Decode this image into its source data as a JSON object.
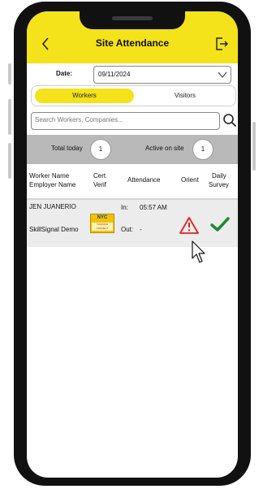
{
  "header": {
    "title": "Site Attendance",
    "status_left": "",
    "status_right": "",
    "back_icon": "chevron-left-icon",
    "logout_icon": "logout-icon"
  },
  "filters": {
    "date_label": "Date:",
    "date_value": "09/11/2024"
  },
  "tabs": [
    {
      "label": "Workers",
      "active": true
    },
    {
      "label": "Visitors",
      "active": false
    }
  ],
  "search": {
    "placeholder": "Search Workers, Companies..."
  },
  "stats": {
    "total_label": "Total today",
    "total_value": "1",
    "active_label": "Active on site",
    "active_value": "1"
  },
  "table": {
    "headers": {
      "worker_line1": "Worker Name",
      "worker_line2": "Employer Name",
      "cert_line1": "Cert",
      "cert_line2": "Verif",
      "attendance": "Attendance",
      "orient": "Orient",
      "survey_line1": "Daily",
      "survey_line2": "Survey"
    },
    "rows": [
      {
        "worker_name": "JEN JUANERIO",
        "employer": "SkillSignal Demo",
        "cert_logo_top": "NYC",
        "cert_logo_bottom": "TRAINING CONNECT",
        "in_label": "In:",
        "in_time": "05:57 AM",
        "out_label": "Out:",
        "out_time": "-",
        "orient_status": "warning",
        "survey_status": "complete"
      }
    ]
  },
  "colors": {
    "accent": "#f4e21a",
    "stats_bg": "#b9b9b9",
    "warning": "#e02020",
    "success": "#1e8a2e"
  }
}
